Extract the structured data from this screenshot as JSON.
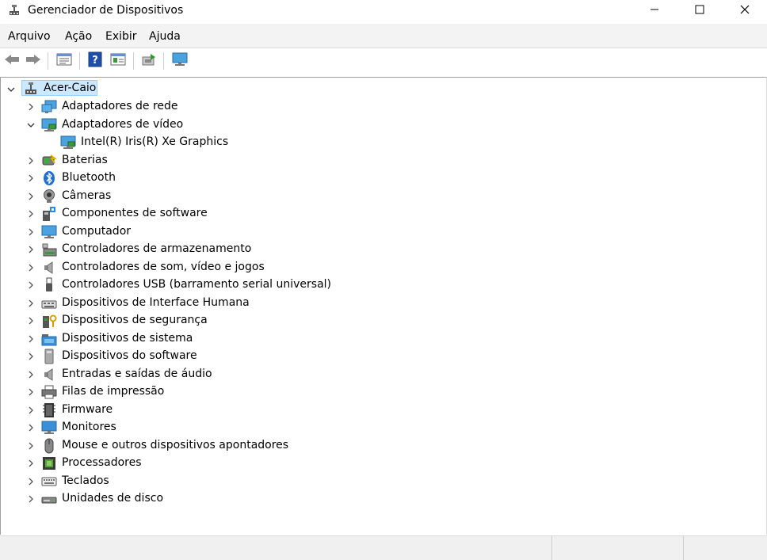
{
  "window": {
    "title": "Gerenciador de Dispositivos"
  },
  "menu": [
    "Arquivo",
    "Ação",
    "Exibir",
    "Ajuda"
  ],
  "toolbar": {
    "icons": [
      "back-arrow-icon",
      "forward-arrow-icon",
      "properties-window-icon",
      "help-icon",
      "update-driver-window-icon",
      "scan-hardware-icon",
      "monitor-network-icon"
    ]
  },
  "tree": {
    "root": "Acer-Caio",
    "items": [
      {
        "label": "Adaptadores de rede",
        "icon": "network-adapter-icon",
        "expanded": false
      },
      {
        "label": "Adaptadores de vídeo",
        "icon": "display-adapter-icon",
        "expanded": true
      },
      {
        "label": "Intel(R) Iris(R) Xe Graphics",
        "icon": "display-adapter-icon",
        "child": true
      },
      {
        "label": "Baterias",
        "icon": "battery-icon",
        "expanded": false
      },
      {
        "label": "Bluetooth",
        "icon": "bluetooth-icon",
        "expanded": false
      },
      {
        "label": "Câmeras",
        "icon": "camera-icon",
        "expanded": false
      },
      {
        "label": "Componentes de software",
        "icon": "software-component-icon",
        "expanded": false
      },
      {
        "label": "Computador",
        "icon": "computer-icon",
        "expanded": false
      },
      {
        "label": "Controladores de armazenamento",
        "icon": "storage-controller-icon",
        "expanded": false
      },
      {
        "label": "Controladores de som, vídeo e jogos",
        "icon": "speaker-icon",
        "expanded": false
      },
      {
        "label": "Controladores USB (barramento serial universal)",
        "icon": "usb-icon",
        "expanded": false
      },
      {
        "label": "Dispositivos de Interface Humana",
        "icon": "hid-icon",
        "expanded": false
      },
      {
        "label": "Dispositivos de segurança",
        "icon": "security-device-icon",
        "expanded": false
      },
      {
        "label": "Dispositivos de sistema",
        "icon": "system-folder-icon",
        "expanded": false
      },
      {
        "label": "Dispositivos do software",
        "icon": "software-device-icon",
        "expanded": false
      },
      {
        "label": "Entradas e saídas de áudio",
        "icon": "speaker-icon",
        "expanded": false
      },
      {
        "label": "Filas de impressão",
        "icon": "printer-icon",
        "expanded": false
      },
      {
        "label": "Firmware",
        "icon": "firmware-icon",
        "expanded": false
      },
      {
        "label": "Monitores",
        "icon": "monitor-icon",
        "expanded": false
      },
      {
        "label": "Mouse e outros dispositivos apontadores",
        "icon": "mouse-icon",
        "expanded": false
      },
      {
        "label": "Processadores",
        "icon": "processor-icon",
        "expanded": false
      },
      {
        "label": "Teclados",
        "icon": "keyboard-icon",
        "expanded": false
      },
      {
        "label": "Unidades de disco",
        "icon": "disk-drive-icon",
        "expanded": false
      }
    ]
  }
}
